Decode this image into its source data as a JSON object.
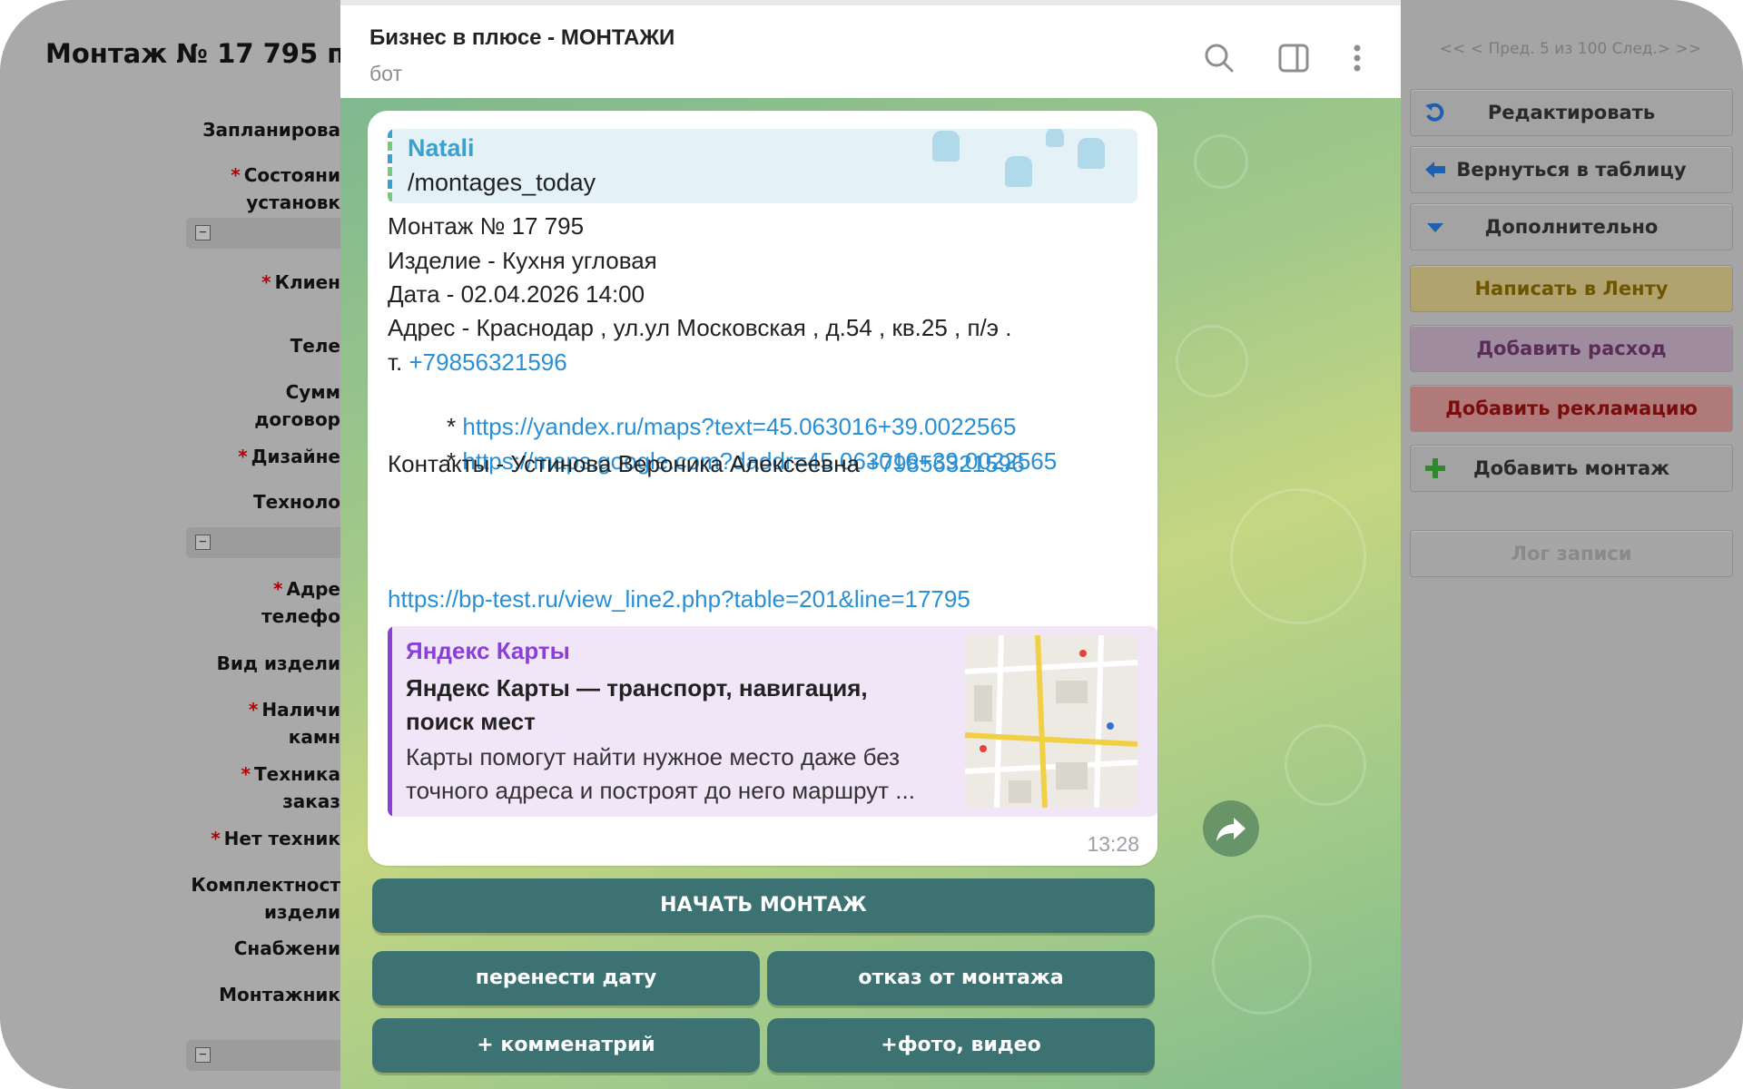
{
  "form": {
    "page_title": "Монтаж № 17 795 по",
    "fields": [
      {
        "label": "Запланирова",
        "required": false
      },
      {
        "label": "Состояни",
        "required": true
      },
      {
        "label": "установк",
        "required": false
      },
      {
        "label": "Клиен",
        "required": true
      },
      {
        "label": "Теле",
        "required": false
      },
      {
        "label": "Сумм",
        "required": false
      },
      {
        "label": "договор",
        "required": false
      },
      {
        "label": "Дизайне",
        "required": true
      },
      {
        "label": "Техноло",
        "required": false
      },
      {
        "label": "Адре",
        "required": true
      },
      {
        "label": "телефо",
        "required": false
      },
      {
        "label": "Вид издели",
        "required": false
      },
      {
        "label": "Наличи",
        "required": true
      },
      {
        "label": "камн",
        "required": false
      },
      {
        "label": "Техника",
        "required": true
      },
      {
        "label": "заказ",
        "required": false
      },
      {
        "label": "Нет техник",
        "required": true
      },
      {
        "label": "Комплектност",
        "required": false
      },
      {
        "label": "издели",
        "required": false
      },
      {
        "label": "Снабжени",
        "required": false
      },
      {
        "label": "Монтажник",
        "required": false
      }
    ],
    "collapse_symbol": "−"
  },
  "right_panel": {
    "record_nav": "<< < Пред. 5 из 100 След.> >>",
    "buttons": {
      "edit": "Редактировать",
      "back_to_table": "Вернуться в таблицу",
      "more": "Дополнительно",
      "write_feed": "Написать в Ленту",
      "add_expense": "Добавить расход",
      "add_claim": "Добавить рекламацию",
      "add_montage": "Добавить монтаж",
      "log": "Лог записи"
    }
  },
  "telegram": {
    "chat_title": "Бизнес в плюсе - МОНТАЖИ",
    "chat_subtitle": "бот",
    "header_icons": [
      "search-icon",
      "sidebar-toggle-icon",
      "more-vertical-icon"
    ],
    "message": {
      "reply_author": "Natali",
      "reply_text": "/montages_today",
      "lines": {
        "montage_no": "Монтаж № 17 795",
        "product": "Изделие - Кухня угловая",
        "date": "Дата - 02.04.2026 14:00",
        "address": "Адрес - Краснодар , ул.ул Московская , д.54 , кв.25 , п/э .",
        "phone_prefix": "т. ",
        "phone": "+79856321596",
        "star": " * ",
        "yandex_link": "https://yandex.ru/maps?text=45.063016+39.0022565",
        "google_link": "https://maps.google.com?daddr=45.063016+39.0022565",
        "contacts_prefix": "Контакты - Устинова Вероника Алексеевна ",
        "contacts_phone": "+79856321596",
        "record_link": "https://bp-test.ru/view_line2.php?table=201&line=17795"
      },
      "preview": {
        "site": "Яндекс Карты",
        "title": "Яндекс Карты — транспорт, навигация, поиск мест",
        "description": "Карты помогут найти нужное место даже без точного адреса и построят до него маршрут ..."
      },
      "time": "13:28"
    },
    "keyboard": {
      "start": "НАЧАТЬ МОНТАЖ",
      "reschedule": "перенести дату",
      "refuse": "отказ от монтажа",
      "comment": "+ комменатрий",
      "media": "+фото, видео"
    },
    "colors": {
      "link": "#2a8fd3",
      "keyboard_button": "#3c7272",
      "reply_accent": "#3ba1cf",
      "preview_accent": "#8a3fd6"
    }
  }
}
